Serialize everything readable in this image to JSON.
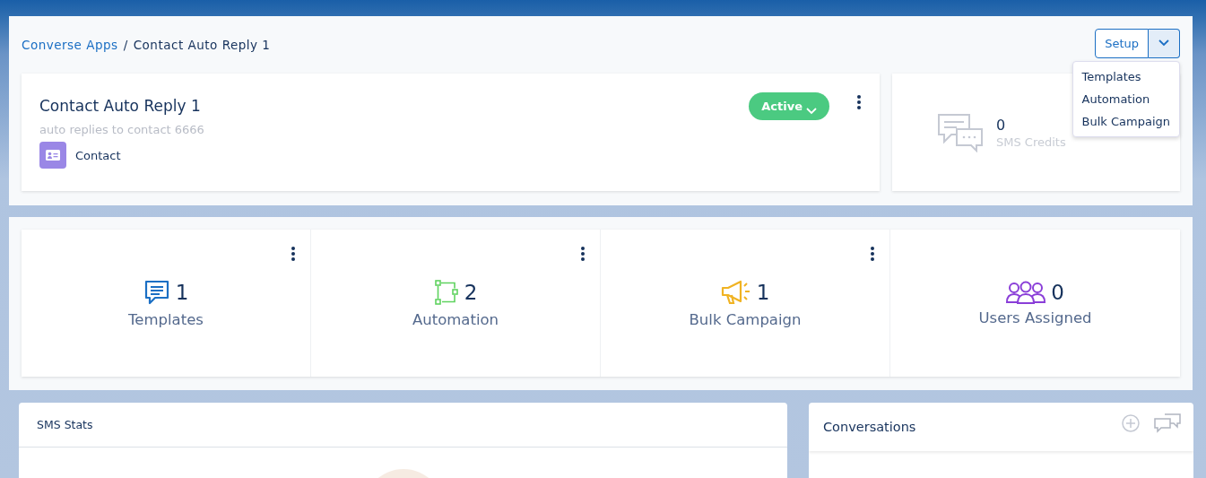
{
  "breadcrumb": {
    "parent": "Converse Apps",
    "separator": "/",
    "current": "Contact Auto Reply 1"
  },
  "setup": {
    "label": "Setup",
    "expanded": true,
    "menu": [
      "Templates",
      "Automation",
      "Bulk Campaign"
    ]
  },
  "app_card": {
    "title": "Contact Auto Reply 1",
    "description": "auto replies to contact 6666",
    "object": "Contact",
    "status": "Active"
  },
  "credits": {
    "value": "0",
    "label": "SMS Credits"
  },
  "stats": [
    {
      "kind": "templates",
      "value": "1",
      "label": "Templates",
      "menu": true
    },
    {
      "kind": "automation",
      "value": "2",
      "label": "Automation",
      "menu": true
    },
    {
      "kind": "campaign",
      "value": "1",
      "label": "Bulk Campaign",
      "menu": true
    },
    {
      "kind": "users",
      "value": "0",
      "label": "Users Assigned",
      "menu": false
    }
  ],
  "sms_stats": {
    "title": "SMS Stats"
  },
  "conversations": {
    "title": "Conversations"
  }
}
